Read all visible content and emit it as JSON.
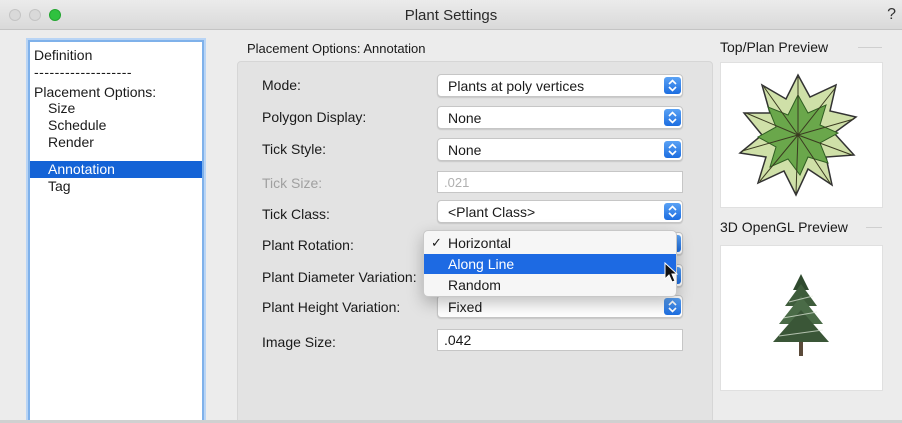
{
  "window": {
    "title": "Plant Settings",
    "help": "?"
  },
  "nav": {
    "items": [
      {
        "label": "Definition",
        "type": "top"
      },
      {
        "label": "-------------------",
        "type": "top"
      },
      {
        "label": "Placement Options:",
        "type": "top"
      },
      {
        "label": "Size",
        "type": "sub"
      },
      {
        "label": "Schedule",
        "type": "sub"
      },
      {
        "label": "Render",
        "type": "sub"
      },
      {
        "label": "Annotation",
        "type": "sub",
        "selected": true
      },
      {
        "label": "Tag",
        "type": "sub"
      }
    ]
  },
  "section_title": "Placement Options: Annotation",
  "fields": {
    "mode": {
      "label": "Mode:",
      "value": "Plants at poly vertices"
    },
    "polygon_display": {
      "label": "Polygon Display:",
      "value": "None"
    },
    "tick_style": {
      "label": "Tick Style:",
      "value": "None"
    },
    "tick_size": {
      "label": "Tick Size:",
      "value": ".021"
    },
    "tick_class": {
      "label": "Tick Class:",
      "value": "<Plant Class>"
    },
    "plant_rotation": {
      "label": "Plant Rotation:",
      "value": "Along Line"
    },
    "plant_diameter_variation": {
      "label": "Plant Diameter Variation:"
    },
    "plant_height_variation": {
      "label": "Plant Height Variation:",
      "value": "Fixed"
    },
    "image_size": {
      "label": "Image Size:",
      "value": ".042"
    }
  },
  "rotation_menu": {
    "options": [
      {
        "label": "Horizontal",
        "checked": true
      },
      {
        "label": "Along Line",
        "highlighted": true
      },
      {
        "label": "Random"
      }
    ],
    "check_mark": "✓"
  },
  "previews": {
    "top_plan": {
      "title": "Top/Plan Preview"
    },
    "opengl": {
      "title": "3D OpenGL Preview"
    }
  },
  "colors": {
    "accent": "#1463d6",
    "stepper": "#2f7de8"
  }
}
